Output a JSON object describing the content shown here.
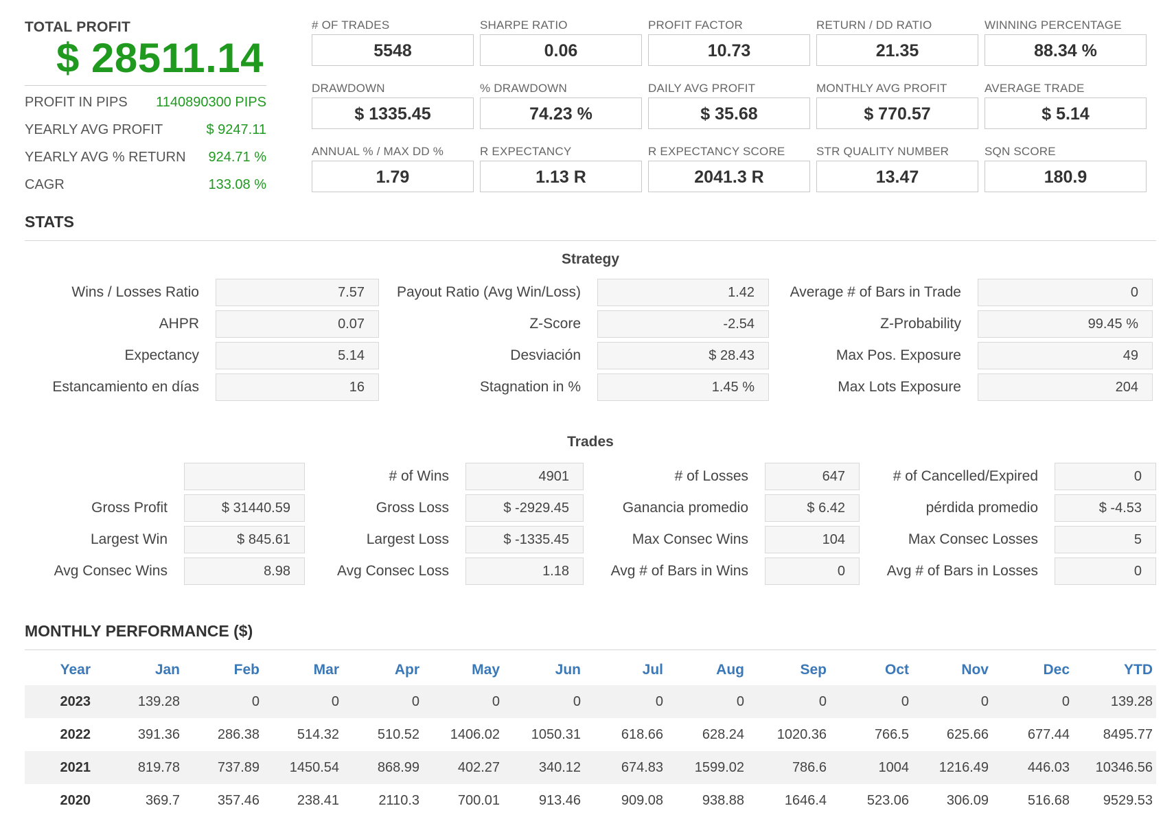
{
  "summary": {
    "total_profit_label": "TOTAL PROFIT",
    "total_profit_value": "$ 28511.14",
    "rows": [
      {
        "label": "PROFIT IN PIPS",
        "value": "1140890300 PIPS"
      },
      {
        "label": "YEARLY AVG PROFIT",
        "value": "$ 9247.11"
      },
      {
        "label": "YEARLY AVG % RETURN",
        "value": "924.71 %"
      },
      {
        "label": "CAGR",
        "value": "133.08 %"
      }
    ],
    "accent_color": "#1f9a1f"
  },
  "metrics": [
    {
      "label": "# OF TRADES",
      "value": "5548"
    },
    {
      "label": "SHARPE RATIO",
      "value": "0.06"
    },
    {
      "label": "PROFIT FACTOR",
      "value": "10.73"
    },
    {
      "label": "RETURN / DD RATIO",
      "value": "21.35"
    },
    {
      "label": "WINNING PERCENTAGE",
      "value": "88.34 %"
    },
    {
      "label": "DRAWDOWN",
      "value": "$ 1335.45"
    },
    {
      "label": "% DRAWDOWN",
      "value": "74.23 %"
    },
    {
      "label": "DAILY AVG PROFIT",
      "value": "$ 35.68"
    },
    {
      "label": "MONTHLY AVG PROFIT",
      "value": "$ 770.57"
    },
    {
      "label": "AVERAGE TRADE",
      "value": "$ 5.14"
    },
    {
      "label": "ANNUAL % / MAX DD %",
      "value": "1.79"
    },
    {
      "label": "R EXPECTANCY",
      "value": "1.13 R"
    },
    {
      "label": "R EXPECTANCY SCORE",
      "value": "2041.3 R"
    },
    {
      "label": "STR QUALITY NUMBER",
      "value": "13.47"
    },
    {
      "label": "SQN SCORE",
      "value": "180.9"
    }
  ],
  "stats": {
    "title": "STATS",
    "strategy_title": "Strategy",
    "strategy": [
      [
        {
          "label": "Wins / Losses Ratio",
          "value": "7.57"
        },
        {
          "label": "Payout Ratio (Avg Win/Loss)",
          "value": "1.42"
        },
        {
          "label": "Average # of Bars in Trade",
          "value": "0"
        }
      ],
      [
        {
          "label": "AHPR",
          "value": "0.07"
        },
        {
          "label": "Z-Score",
          "value": "-2.54"
        },
        {
          "label": "Z-Probability",
          "value": "99.45 %"
        }
      ],
      [
        {
          "label": "Expectancy",
          "value": "5.14"
        },
        {
          "label": "Desviación",
          "value": "$ 28.43"
        },
        {
          "label": "Max Pos. Exposure",
          "value": "49"
        }
      ],
      [
        {
          "label": "Estancamiento en días",
          "value": "16"
        },
        {
          "label": "Stagnation in %",
          "value": "1.45 %"
        },
        {
          "label": "Max Lots Exposure",
          "value": "204"
        }
      ]
    ],
    "trades_title": "Trades",
    "trades": [
      [
        {
          "label": "",
          "value": ""
        },
        {
          "label": "# of Wins",
          "value": "4901"
        },
        {
          "label": "# of Losses",
          "value": "647"
        },
        {
          "label": "# of Cancelled/Expired",
          "value": "0"
        }
      ],
      [
        {
          "label": "Gross Profit",
          "value": "$ 31440.59"
        },
        {
          "label": "Gross Loss",
          "value": "$ -2929.45"
        },
        {
          "label": "Ganancia promedio",
          "value": "$ 6.42"
        },
        {
          "label": "pérdida promedio",
          "value": "$ -4.53"
        }
      ],
      [
        {
          "label": "Largest Win",
          "value": "$ 845.61"
        },
        {
          "label": "Largest Loss",
          "value": "$ -1335.45"
        },
        {
          "label": "Max Consec Wins",
          "value": "104"
        },
        {
          "label": "Max Consec Losses",
          "value": "5"
        }
      ],
      [
        {
          "label": "Avg Consec Wins",
          "value": "8.98"
        },
        {
          "label": "Avg Consec Loss",
          "value": "1.18"
        },
        {
          "label": "Avg # of Bars in Wins",
          "value": "0"
        },
        {
          "label": "Avg # of Bars in Losses",
          "value": "0"
        }
      ]
    ]
  },
  "monthly": {
    "title": "MONTHLY PERFORMANCE ($)",
    "header_color": "#3a78b8",
    "columns": [
      "Year",
      "Jan",
      "Feb",
      "Mar",
      "Apr",
      "May",
      "Jun",
      "Jul",
      "Aug",
      "Sep",
      "Oct",
      "Nov",
      "Dec",
      "YTD"
    ],
    "rows": [
      [
        "2023",
        "139.28",
        "0",
        "0",
        "0",
        "0",
        "0",
        "0",
        "0",
        "0",
        "0",
        "0",
        "0",
        "139.28"
      ],
      [
        "2022",
        "391.36",
        "286.38",
        "514.32",
        "510.52",
        "1406.02",
        "1050.31",
        "618.66",
        "628.24",
        "1020.36",
        "766.5",
        "625.66",
        "677.44",
        "8495.77"
      ],
      [
        "2021",
        "819.78",
        "737.89",
        "1450.54",
        "868.99",
        "402.27",
        "340.12",
        "674.83",
        "1599.02",
        "786.6",
        "1004",
        "1216.49",
        "446.03",
        "10346.56"
      ],
      [
        "2020",
        "369.7",
        "357.46",
        "238.41",
        "2110.3",
        "700.01",
        "913.46",
        "909.08",
        "938.88",
        "1646.4",
        "523.06",
        "306.09",
        "516.68",
        "9529.53"
      ]
    ]
  }
}
